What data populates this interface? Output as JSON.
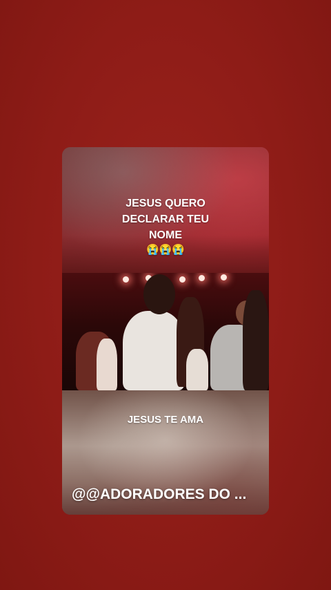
{
  "story": {
    "headline_lines": [
      "JESUS QUERO",
      "DECLARAR TEU",
      "NOME"
    ],
    "headline_emojis": "😭😭😭",
    "caption": "JESUS TE AMA",
    "handle": "@@ADORADORES DO ..."
  },
  "colors": {
    "background": "#8f1d18",
    "text": "#ffffff"
  }
}
